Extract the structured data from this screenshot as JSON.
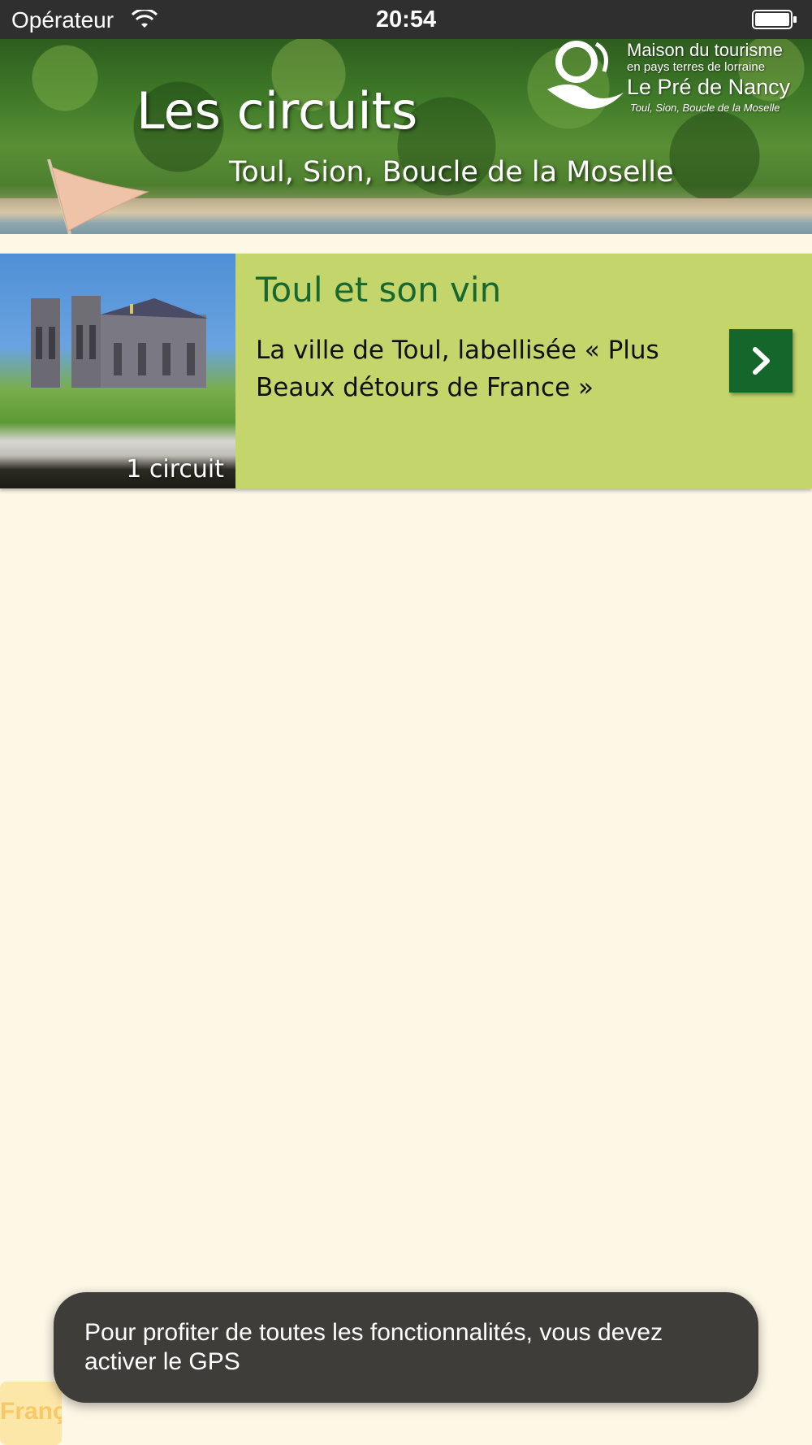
{
  "status_bar": {
    "carrier": "Opérateur",
    "time": "20:54"
  },
  "header": {
    "title": "Les circuits",
    "subtitle": "Toul, Sion, Boucle de la Moselle",
    "logo": {
      "line1": "Maison du tourisme",
      "line2": "en pays terres de lorraine",
      "line3": "Le Pré de Nancy",
      "line4": "Toul, Sion, Boucle de la Moselle"
    }
  },
  "circuits": [
    {
      "title": "Toul et son vin",
      "description": "La ville de Toul, labellisée « Plus Beaux détours de France »",
      "count_label": "1 circuit"
    }
  ],
  "language_button": {
    "label": "Franç"
  },
  "toast": {
    "message": "Pour profiter de toutes les fonctionnalités, vous devez activer le GPS"
  },
  "colors": {
    "background": "#fdf7e6",
    "card_background": "#c4d56c",
    "title_green": "#17672f",
    "button_green": "#14662b",
    "toast_background": "#3f3d39",
    "status_bar": "#2f2f2f"
  },
  "icons": {
    "status": [
      "wifi-icon",
      "battery-icon"
    ],
    "card_action": "chevron-right-icon"
  }
}
